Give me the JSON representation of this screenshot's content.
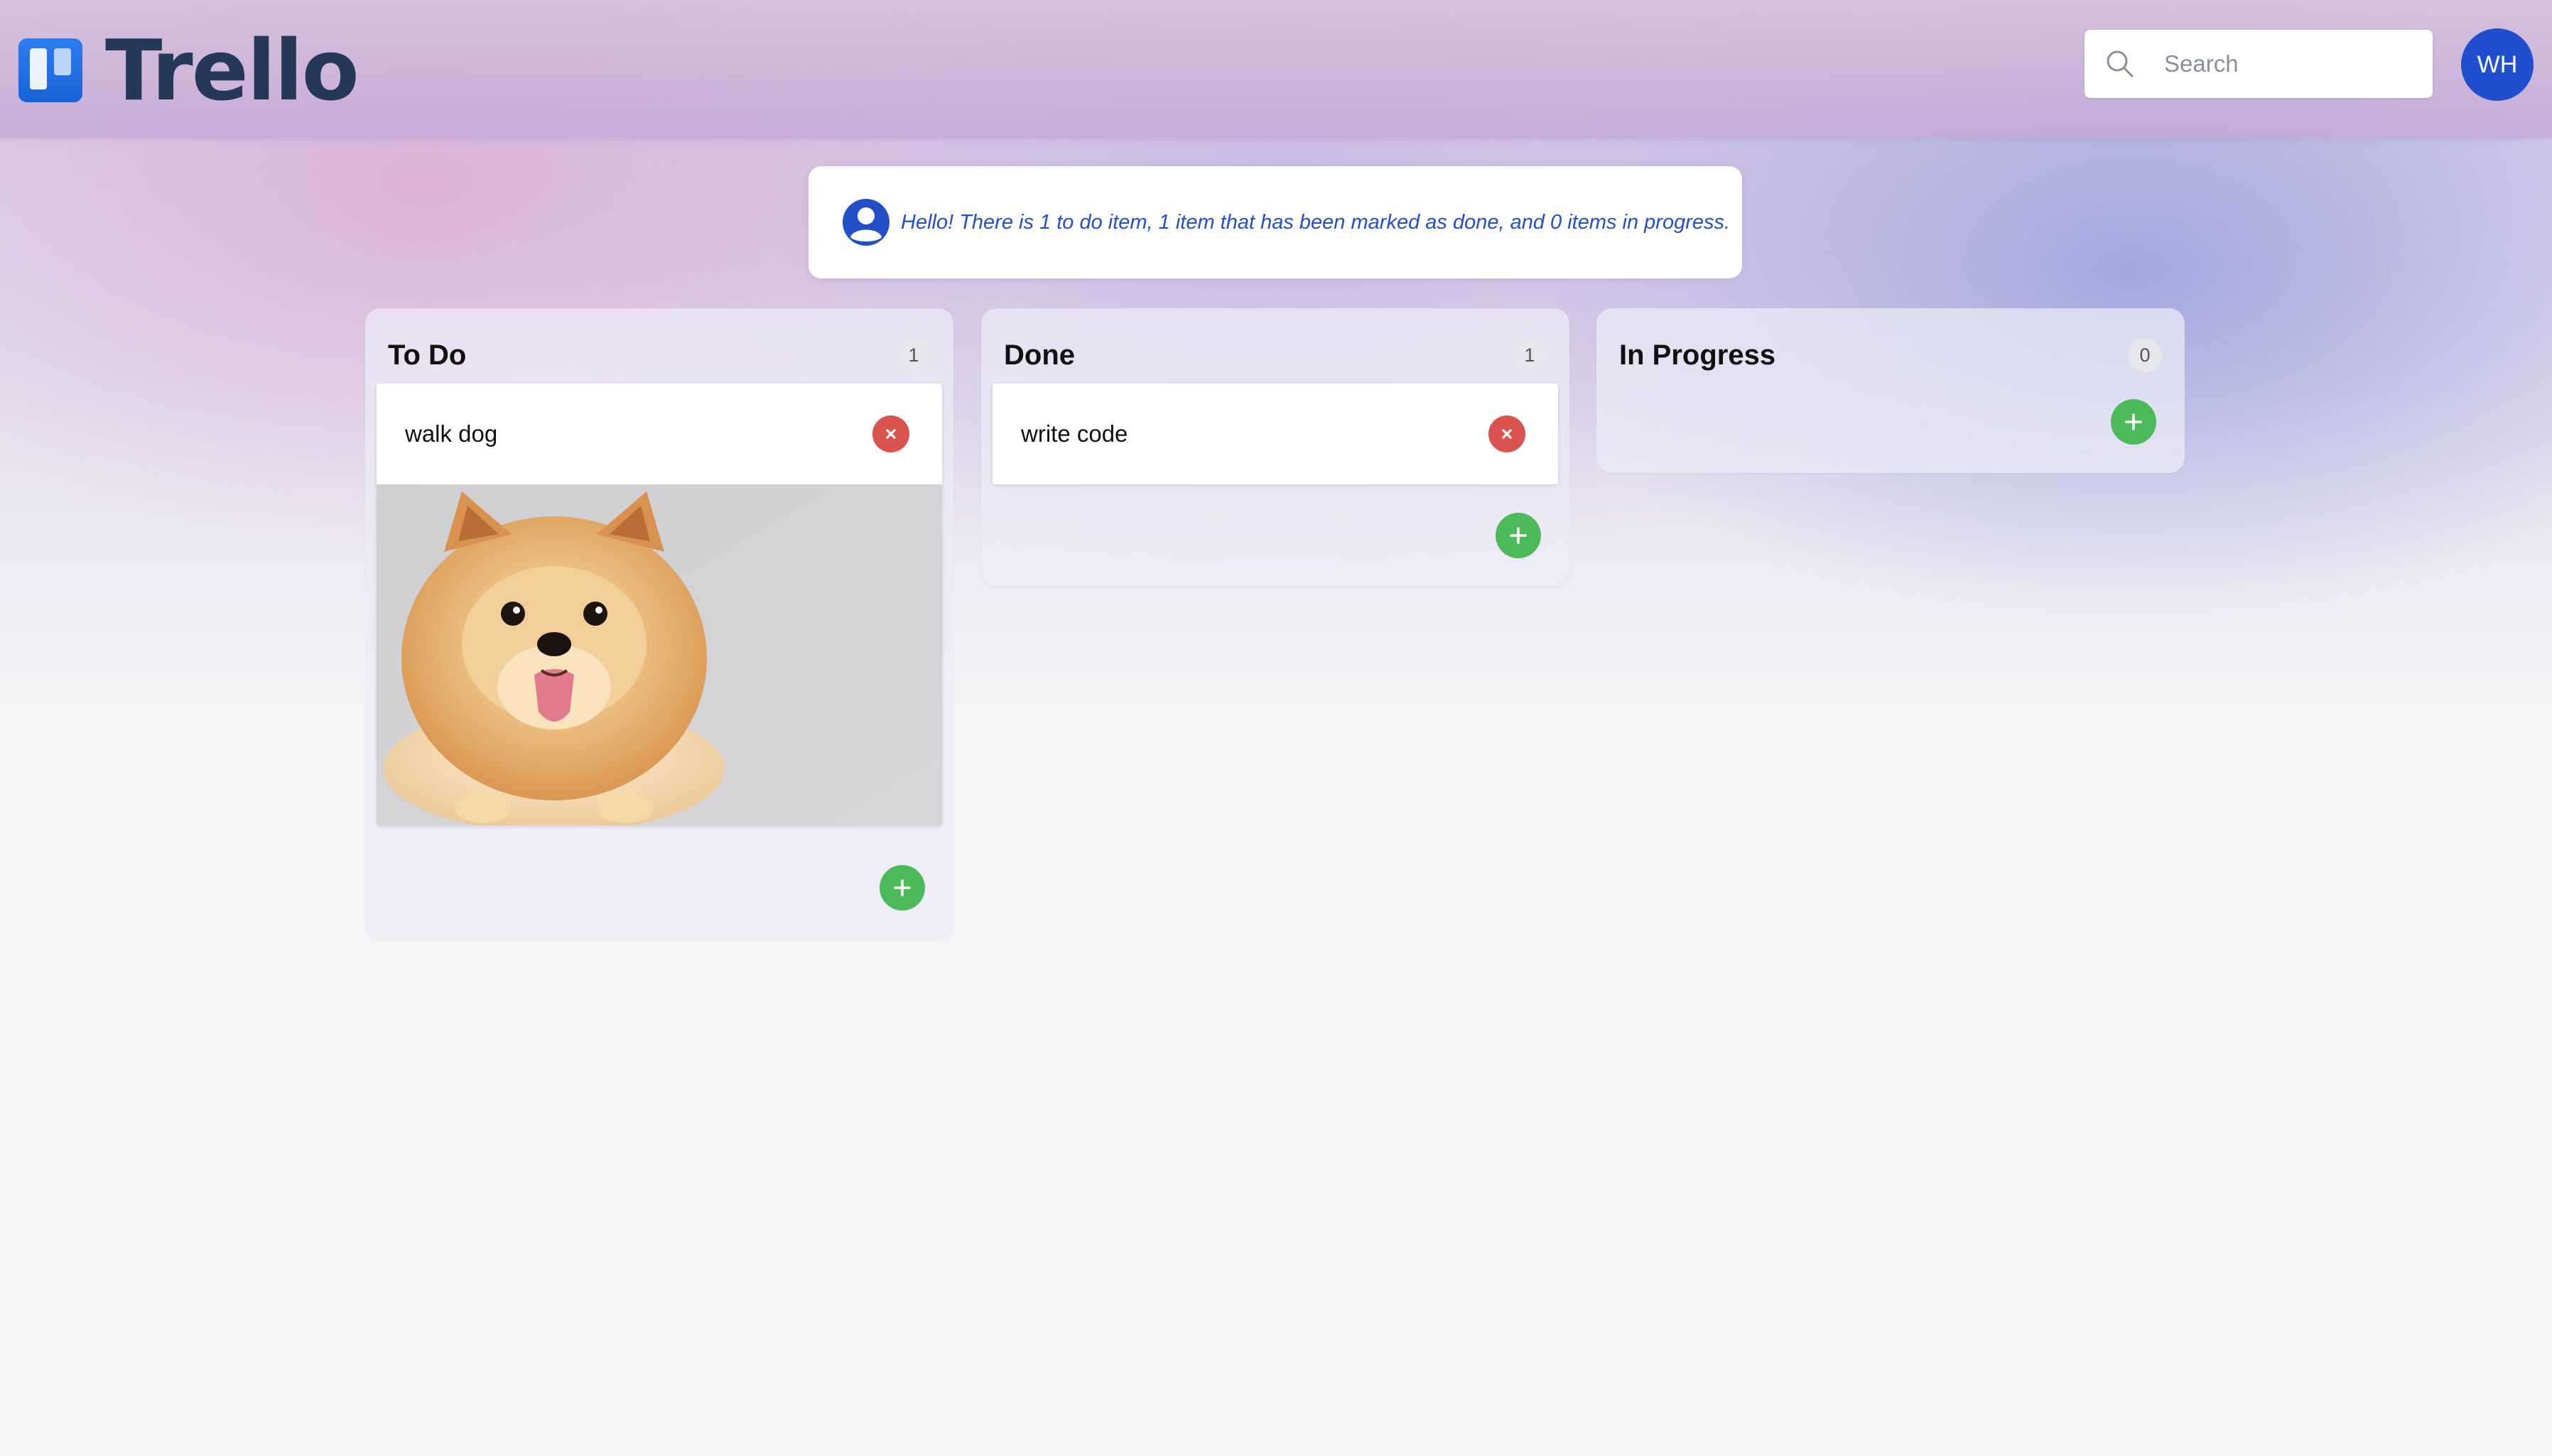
{
  "app": {
    "title": "Trello",
    "brand_color": "#1762d6",
    "logo_text_color": "#253858"
  },
  "header": {
    "search": {
      "placeholder": "Search",
      "value": "",
      "icon": "search-icon"
    },
    "avatar": {
      "initials": "WH",
      "color": "#1f4fcf"
    }
  },
  "banner": {
    "icon": "user-circle-icon",
    "text": "Hello! There is 1 to do item, 1 item that has been marked as done, and 0 items in progress."
  },
  "columns": [
    {
      "title": "To Do",
      "count": "1",
      "cards": [
        {
          "title": "walk dog",
          "has_image": true,
          "image_subject": "pomeranian dog"
        }
      ],
      "add_icon": "plus-icon"
    },
    {
      "title": "Done",
      "count": "1",
      "cards": [
        {
          "title": "write code",
          "has_image": false
        }
      ],
      "add_icon": "plus-icon"
    },
    {
      "title": "In Progress",
      "count": "0",
      "cards": [],
      "add_icon": "plus-icon"
    }
  ],
  "colors": {
    "delete": "#d9534f",
    "add": "#4cba5a",
    "banner_text": "#2350c8"
  }
}
